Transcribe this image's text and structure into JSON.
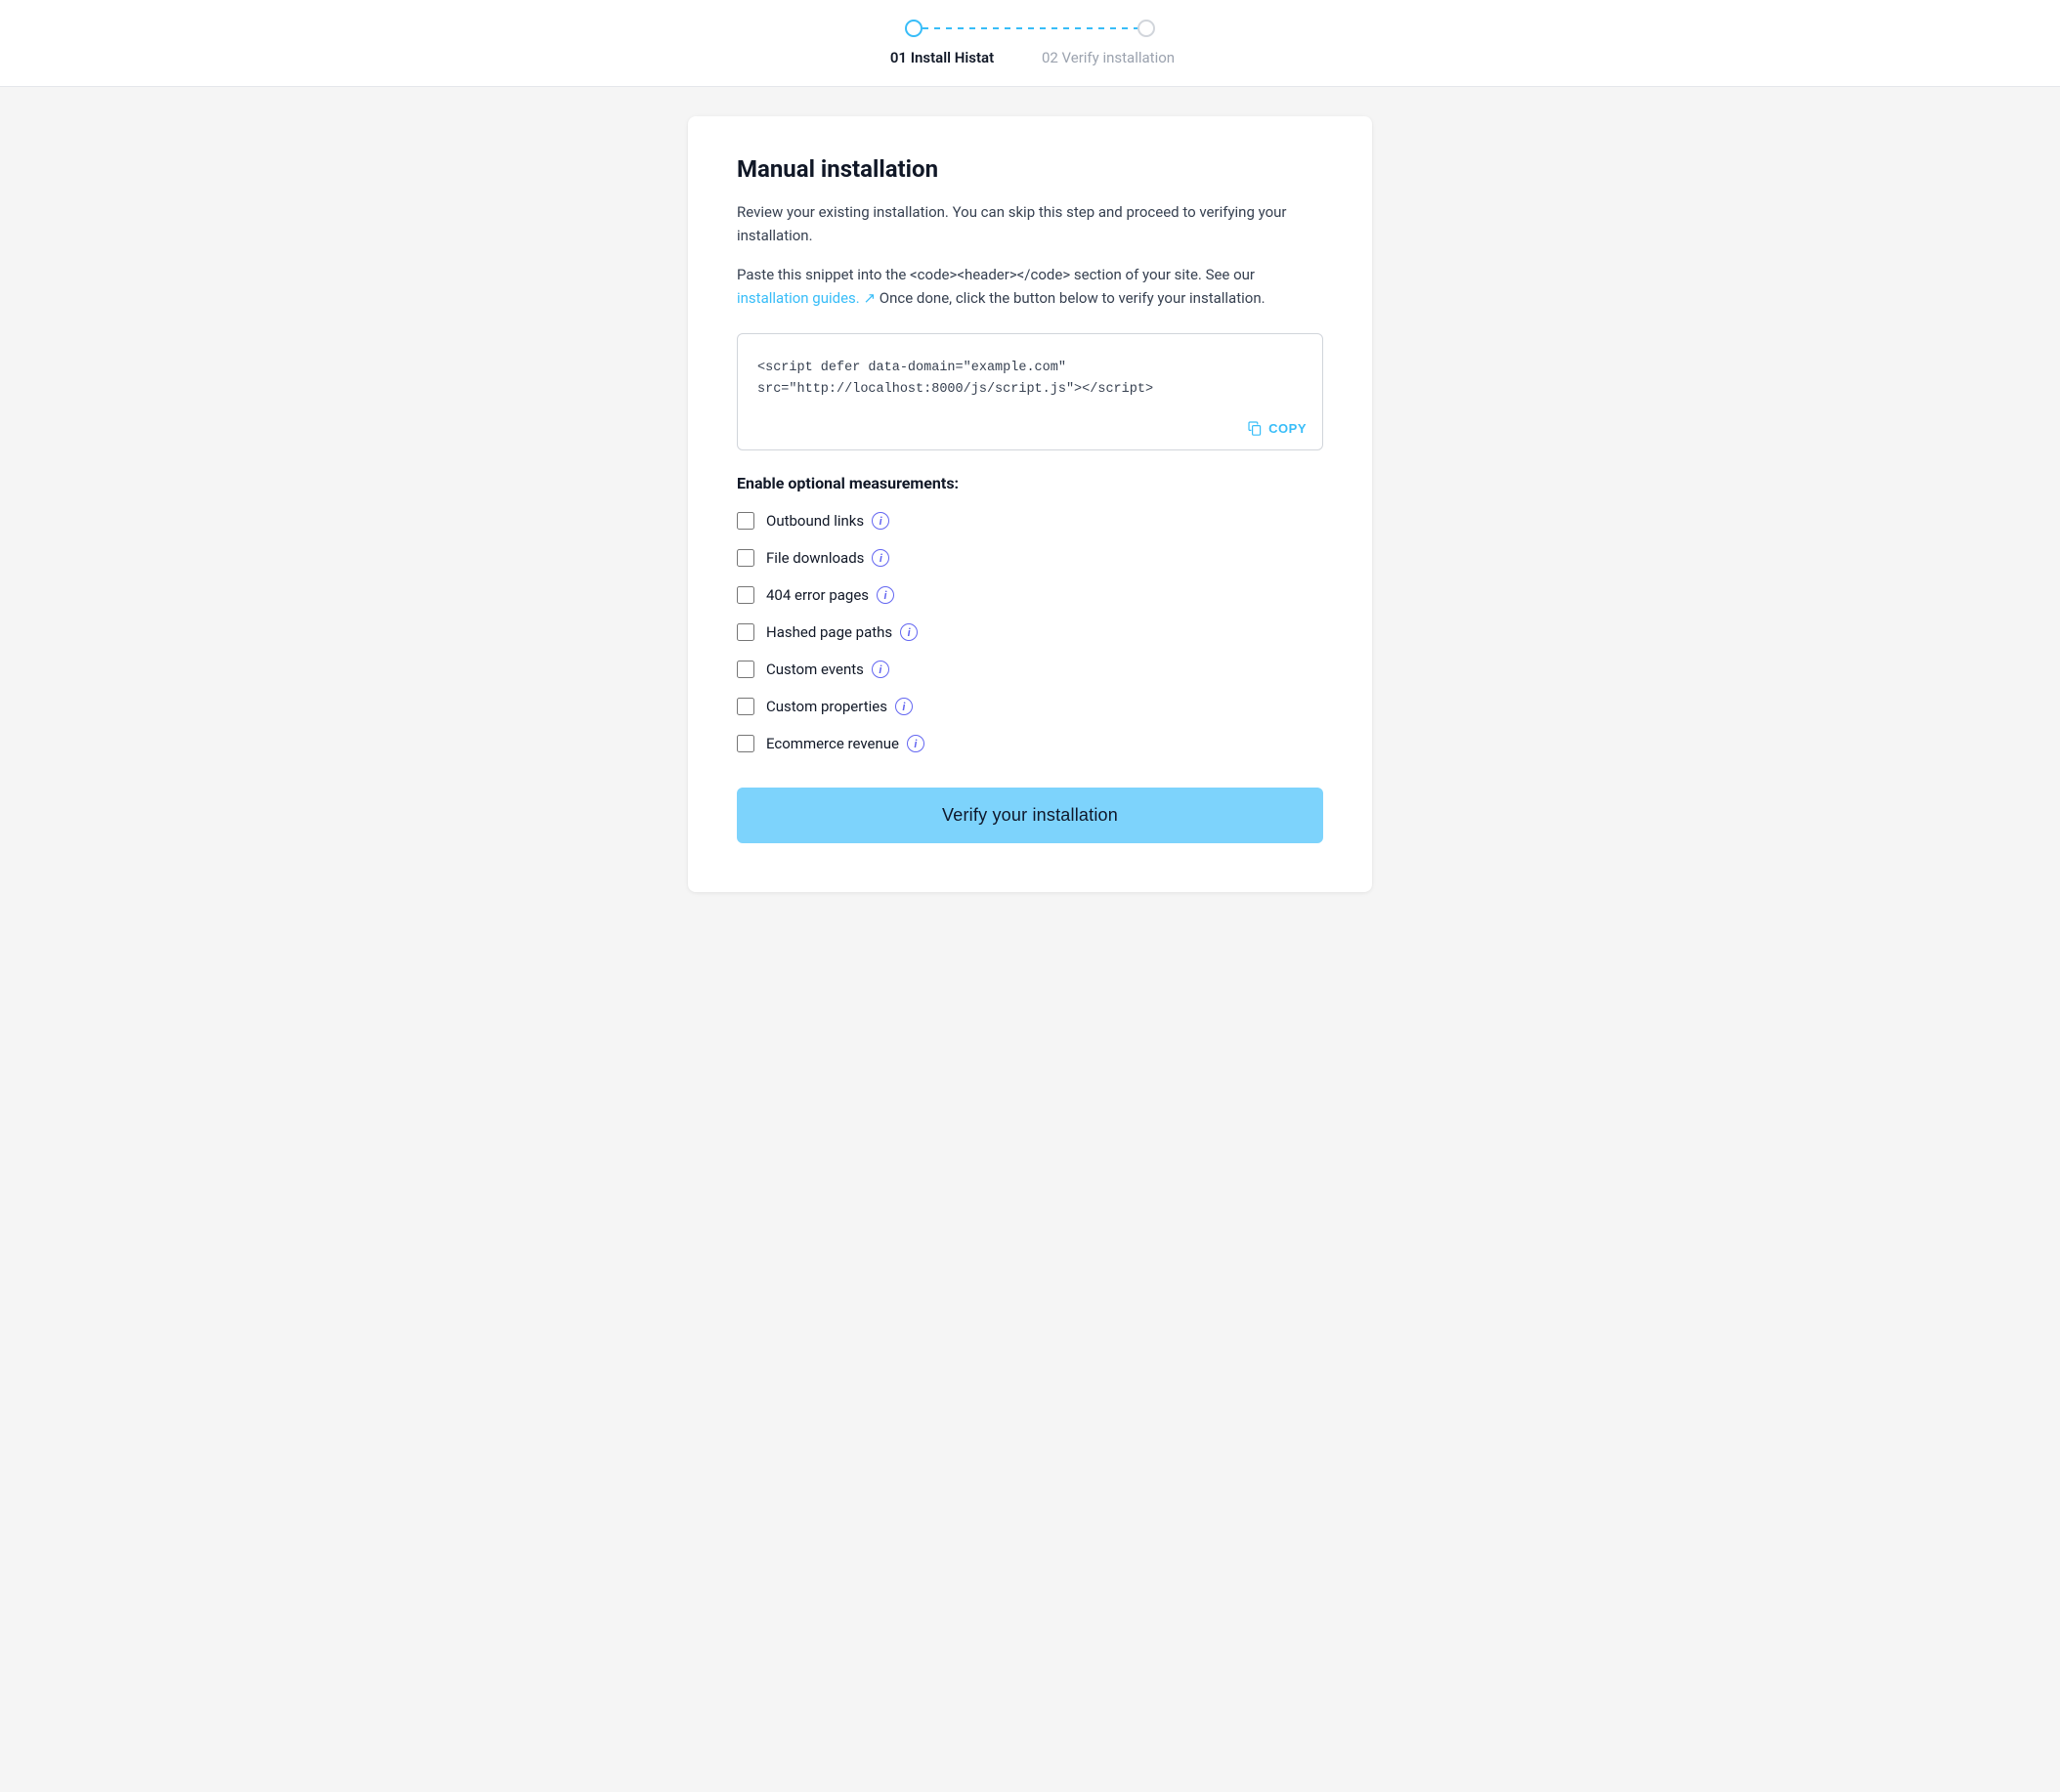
{
  "stepper": {
    "step1_label": "01 Install Histat",
    "step2_label": "02 Verify installation"
  },
  "main": {
    "title": "Manual installation",
    "description1": "Review your existing installation. You can skip this step and proceed to verifying your installation.",
    "description2_pre": "Paste this snippet into the <code><header></code> section of your site. See our ",
    "description2_link": "installation guides.",
    "description2_post": " Once done, click the button below to verify your installation.",
    "code_snippet": "<script defer data-domain=\"example.com\"\nsrc=\"http://localhost:8000/js/script.js\"></script>",
    "copy_label": "COPY",
    "measurements_title": "Enable optional measurements:",
    "checkboxes": [
      {
        "id": "outbound",
        "label": "Outbound links"
      },
      {
        "id": "filedownloads",
        "label": "File downloads"
      },
      {
        "id": "404error",
        "label": "404 error pages"
      },
      {
        "id": "hashed",
        "label": "Hashed page paths"
      },
      {
        "id": "customevents",
        "label": "Custom events"
      },
      {
        "id": "customprops",
        "label": "Custom properties"
      },
      {
        "id": "ecommerce",
        "label": "Ecommerce revenue"
      }
    ],
    "verify_button": "Verify your installation"
  }
}
